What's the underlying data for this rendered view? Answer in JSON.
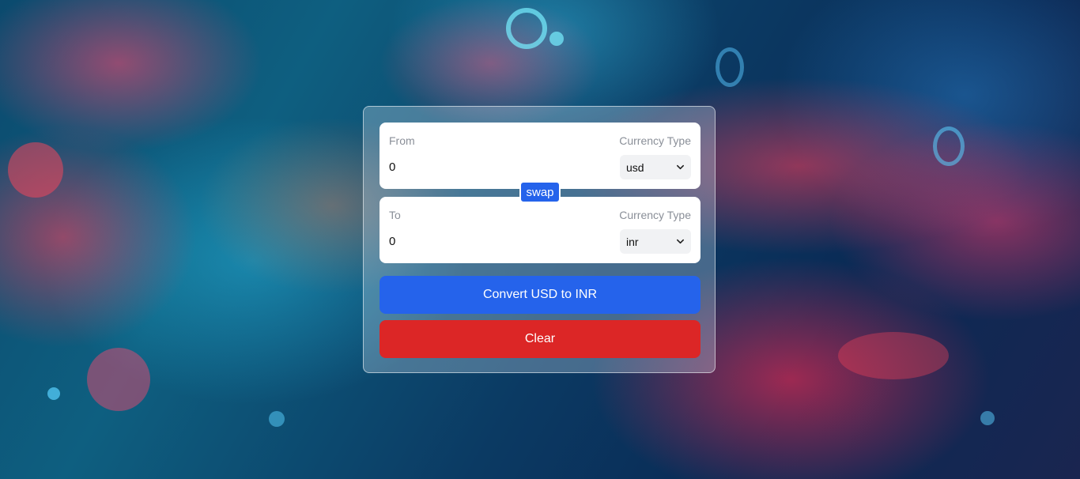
{
  "background": {
    "description_icon": "blockchain-chain-background",
    "colors": {
      "cyan": "#28bee6",
      "red": "#ff3c5a",
      "navy": "#0a2a55"
    }
  },
  "converter": {
    "from": {
      "label": "From",
      "currency_type_label": "Currency Type",
      "amount": "0",
      "currency": "usd"
    },
    "swap_label": "swap",
    "to": {
      "label": "To",
      "currency_type_label": "Currency Type",
      "amount": "0",
      "currency": "inr"
    },
    "convert_label": "Convert USD to INR",
    "clear_label": "Clear"
  },
  "colors": {
    "primary": "#2563eb",
    "danger": "#dc2626",
    "card_border": "#ffffff"
  },
  "icons": {
    "select_arrow": "chevron-down-icon"
  }
}
